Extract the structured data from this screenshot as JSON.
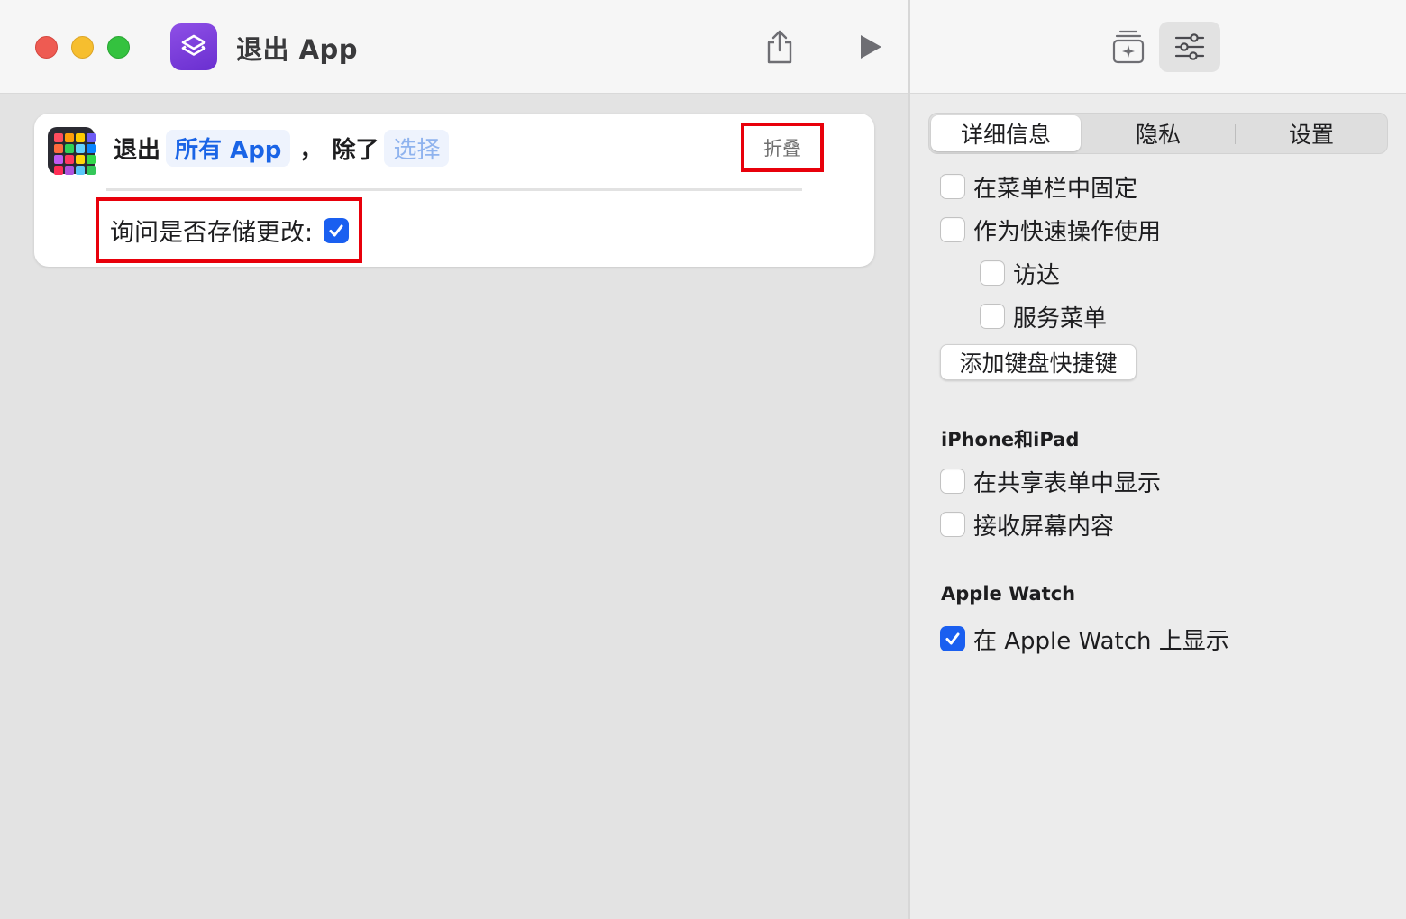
{
  "window": {
    "title": "退出 App"
  },
  "action": {
    "verb": "退出",
    "target_token": "所有 App",
    "comma": "，",
    "except_label": "除了",
    "choose_placeholder": "选择",
    "collapse_label": "折叠",
    "ask_save_label": "询问是否存储更改:",
    "ask_save_checked": true,
    "icon_colors": [
      "#ff4d5e",
      "#ff9f0a",
      "#ffcc00",
      "#6e5cf6",
      "#ff6b3d",
      "#30d158",
      "#64d2ff",
      "#0a84ff",
      "#bf5af2",
      "#ff375f",
      "#ffd60a",
      "#32d74b",
      "#ff2d55",
      "#af52de",
      "#5ac8fa",
      "#34c759"
    ]
  },
  "inspector": {
    "tabs": [
      {
        "label": "详细信息",
        "selected": true
      },
      {
        "label": "隐私",
        "selected": false
      },
      {
        "label": "设置",
        "selected": false
      }
    ],
    "options": {
      "pin_menubar": {
        "label": "在菜单栏中固定",
        "checked": false
      },
      "quick_action": {
        "label": "作为快速操作使用",
        "checked": false
      },
      "finder": {
        "label": "访达",
        "checked": false
      },
      "services_menu": {
        "label": "服务菜单",
        "checked": false
      },
      "share_sheet": {
        "label": "在共享表单中显示",
        "checked": false
      },
      "receive_screen": {
        "label": "接收屏幕内容",
        "checked": false
      },
      "show_on_watch": {
        "label": "在 Apple Watch 上显示",
        "checked": true
      }
    },
    "add_shortcut_button": "添加键盘快捷键",
    "section_iphone": "iPhone和iPad",
    "section_watch": "Apple Watch"
  },
  "colors": {
    "accent": "#1a5ff0",
    "highlight_box": "#e8000b",
    "app_icon": "#7b3fe0"
  }
}
